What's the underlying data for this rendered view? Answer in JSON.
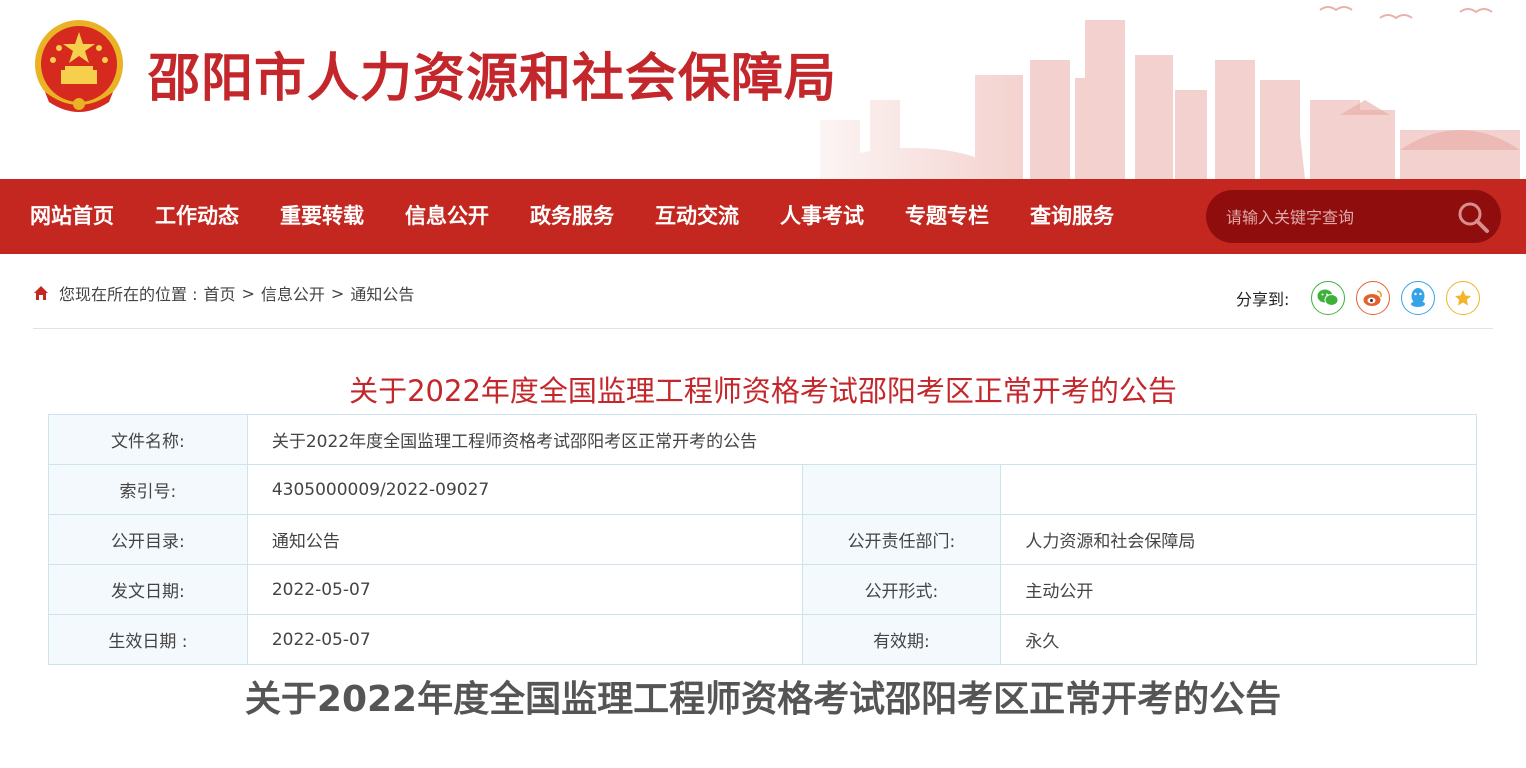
{
  "site": {
    "title": "邵阳市人力资源和社会保障局"
  },
  "nav": {
    "items": [
      "网站首页",
      "工作动态",
      "重要转载",
      "信息公开",
      "政务服务",
      "互动交流",
      "人事考试",
      "专题专栏",
      "查询服务"
    ]
  },
  "search": {
    "placeholder": "请输入关键字查询"
  },
  "breadcrumb": {
    "prefix": "您现在所在的位置 :",
    "items": [
      "首页",
      "信息公开",
      "通知公告"
    ],
    "separator": ">"
  },
  "share": {
    "label": "分享到:",
    "icons": [
      "wechat-icon",
      "weibo-icon",
      "qq-icon",
      "favorite-icon"
    ],
    "colors": {
      "wechat": "#3fb13b",
      "weibo": "#e6602c",
      "qq": "#34a3e8",
      "favorite": "#f2b428"
    }
  },
  "article": {
    "title": "关于2022年度全国监理工程师资格考试邵阳考区正常开考的公告",
    "body_title": "关于2022年度全国监理工程师资格考试邵阳考区正常开考的公告"
  },
  "meta": {
    "file_name_label": "文件名称:",
    "file_name": "关于2022年度全国监理工程师资格考试邵阳考区正常开考的公告",
    "index_label": "索引号:",
    "index": "4305000009/2022-09027",
    "catalog_label": "公开目录:",
    "catalog": "通知公告",
    "dept_label": "公开责任部门:",
    "dept": "人力资源和社会保障局",
    "issue_date_label": "发文日期:",
    "issue_date": "2022-05-07",
    "form_label": "公开形式:",
    "form": "主动公开",
    "effective_date_label": "生效日期 :",
    "effective_date": "2022-05-07",
    "validity_label": "有效期:",
    "validity": "永久"
  },
  "colors": {
    "brand_red": "#c3271f",
    "search_bg": "#8f0d0d",
    "title_red": "#c3272b"
  }
}
